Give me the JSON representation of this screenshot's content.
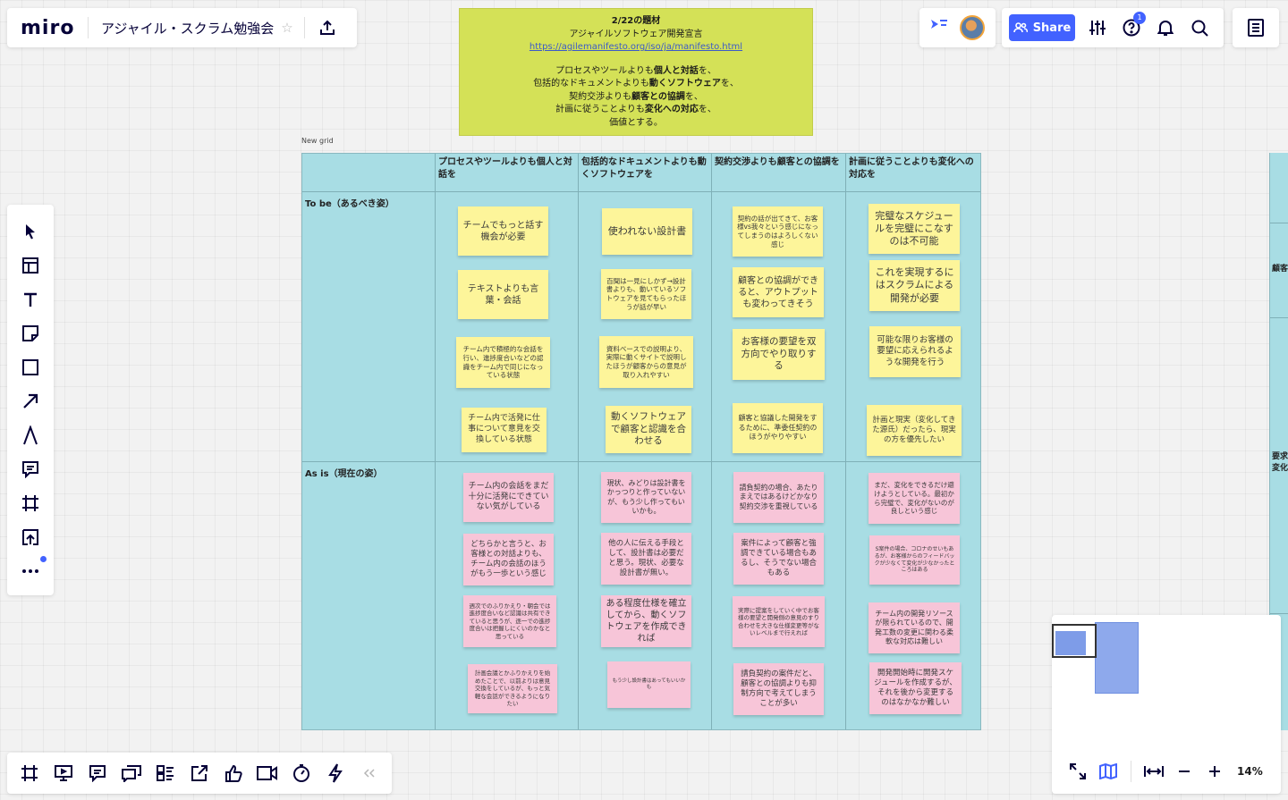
{
  "app": {
    "logo": "miro",
    "board_title": "アジャイル・スクラム勉強会"
  },
  "header": {
    "share_label": "Share",
    "notification_badge": "1"
  },
  "banner": {
    "title": "2/22の題材",
    "subtitle": "アジャイルソフトウェア開発宣言",
    "url": "https://agilemanifesto.org/iso/ja/manifesto.html",
    "lines": [
      [
        "プロセスやツールよりも",
        "個人と対話",
        "を、"
      ],
      [
        "包括的なドキュメントよりも",
        "動くソフトウェア",
        "を、"
      ],
      [
        "契約交渉よりも",
        "顧客との協調",
        "を、"
      ],
      [
        "計画に従うことよりも",
        "変化への対応",
        "を、"
      ],
      [
        "価値とする。",
        "",
        ""
      ]
    ]
  },
  "grid": {
    "label": "New grid",
    "columns": [
      "プロセスやツールよりも個人と対話を",
      "包括的なドキュメントよりも動くソフトウェアを",
      "契約交渉よりも顧客との協調を",
      "計画に従うことよりも変化への対応を"
    ],
    "rows": [
      "To be（あるべき姿）",
      "As is（現在の姿）"
    ],
    "notes": [
      "チームでもっと話す機会が必要",
      "テキストよりも言葉・会話",
      "チーム内で積極的な会話を行い、進捗度合いなどの認識をチーム内で同じになっている状態",
      "チーム内で活発に仕事について意見を交換している状態",
      "使われない設計書",
      "百聞は一見にしかず→設計書よりも、動いているソフトウェアを見てもらったほうが話が早い",
      "資料ベースでの説明より、実際に動くサイトで説明したほうが顧客からの意見が取り入れやすい",
      "動くソフトウェアで顧客と認識を合わせる",
      "契約の話が出てきて、お客様vs我々という感じになってしまうのはよろしくない感じ",
      "顧客との協調ができると、アウトプットも変わってきそう",
      "お客様の要望を双方向でやり取りする",
      "顧客と協議した開発をするために、準委任契約のほうがやりやすい",
      "完璧なスケジュールを完璧にこなすのは不可能",
      "これを実現するにはスクラムによる開発が必要",
      "可能な限りお客様の要望に応えられるような開発を行う",
      "計画と現実（変化してきた源氏）だったら、現実の方を優先したい",
      "チーム内の会話をまだ十分に活発にできていない気がしている",
      "どちらかと言うと、お客様との対話よりも、チーム内の会話のほうがもう一歩という感じ",
      "週次でのふりかえり・朝会では進捗度合いなど認識は共有できていると思うが、逐一での進捗度合いは把握しにくいのかなと思っている",
      "計画会議とかふりかえりを始めたことで、以前よりは意見交換をしているが、もっと気軽な会話ができるようになりたい",
      "現状、みどりは設計書をかっつりと作っていないが、もう少し作ってもいいかも。",
      "他の人に伝える手段として、設計書は必要だと思う。現状、必要な設計書が無い。",
      "ある程度仕様を確立してから、動くソフトウェアを作成できれば",
      "もう少し設計書はあってもいいかも",
      "請負契約の場合、あたりまえではあるけどかなり契約交渉を重視している",
      "案件によって顧客と強調できている場合もあるし、そうでない場合もある",
      "実際に提案をしていく中でお客様の要望と開発側の意見のすり合わせを大きな仕様変更等がないレベルまで行えれば",
      "請負契約の案件だと、顧客との協調よりも抑制方向で考えてしまうことが多い",
      "まだ、変化をできるだけ避けようとしている。最初から完璧で、変化がないのが良しという感じ",
      "S案件の場合、コロナのせいもあるが、お客様からのフィードバックが少なくて変化が少なかったところはある",
      "チーム内の開発リソースが限られているので、開発工数の変更に関わる柔軟な対応は難しい",
      "開発開始時に開発スケジュールを作成するが、それを後から変更するのはなかなか難しい"
    ]
  },
  "right_strip": {
    "texts": [
      "顧客",
      "要求",
      "変化"
    ]
  },
  "zoom": "14%",
  "colors": {
    "sticky_yellow": "#fdf59a",
    "sticky_pink": "#f7c5d8",
    "grid_bg": "#a8dde4",
    "accent": "#4262ff",
    "banner_bg": "#d4e157"
  }
}
